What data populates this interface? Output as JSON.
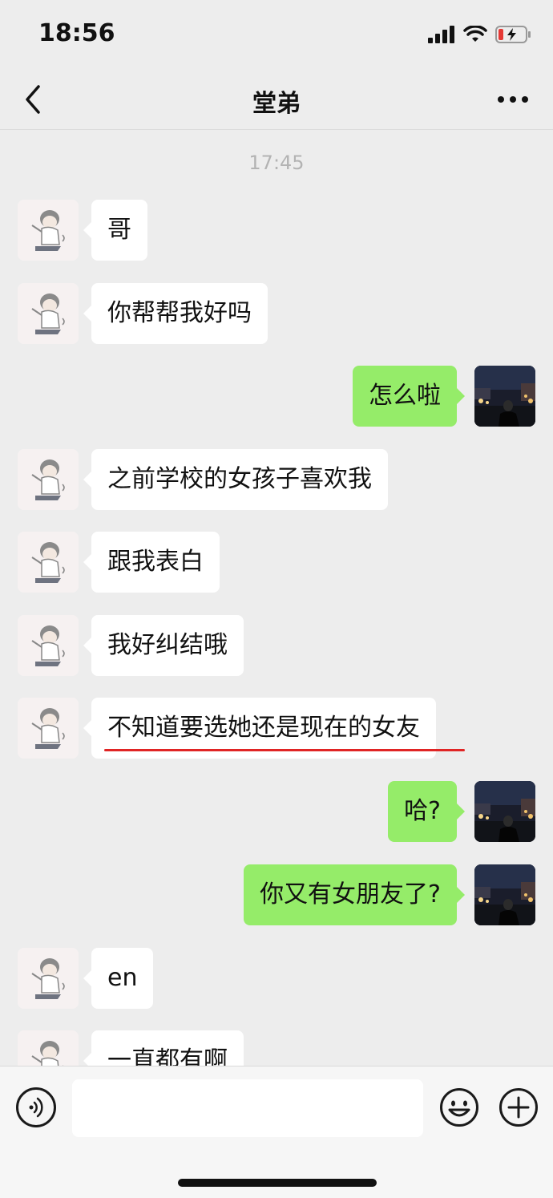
{
  "status_bar": {
    "time": "18:56",
    "icons": [
      "cellular-signal-icon",
      "wifi-icon",
      "battery-low-charging-icon"
    ]
  },
  "nav": {
    "title": "堂弟",
    "back_icon": "chevron-left-icon",
    "more_icon": "more-dots-icon"
  },
  "chat": {
    "timestamp": "17:45",
    "messages": [
      {
        "side": "left",
        "text": "哥"
      },
      {
        "side": "left",
        "text": "你帮帮我好吗"
      },
      {
        "side": "right",
        "text": "怎么啦"
      },
      {
        "side": "left",
        "text": "之前学校的女孩子喜欢我"
      },
      {
        "side": "left",
        "text": "跟我表白"
      },
      {
        "side": "left",
        "text": "我好纠结哦"
      },
      {
        "side": "left",
        "text": "不知道要选她还是现在的女友",
        "underlined": true
      },
      {
        "side": "right",
        "text": "哈?"
      },
      {
        "side": "right",
        "text": "你又有女朋友了?"
      },
      {
        "side": "left",
        "text": "en"
      },
      {
        "side": "left",
        "text": "一直都有啊"
      }
    ]
  },
  "input_bar": {
    "voice_icon": "voice-icon",
    "input_value": "",
    "emoji_icon": "emoji-icon",
    "plus_icon": "plus-icon"
  },
  "colors": {
    "background": "#ededed",
    "own_bubble": "#95ec69",
    "other_bubble": "#ffffff",
    "underline": "#e02424"
  }
}
